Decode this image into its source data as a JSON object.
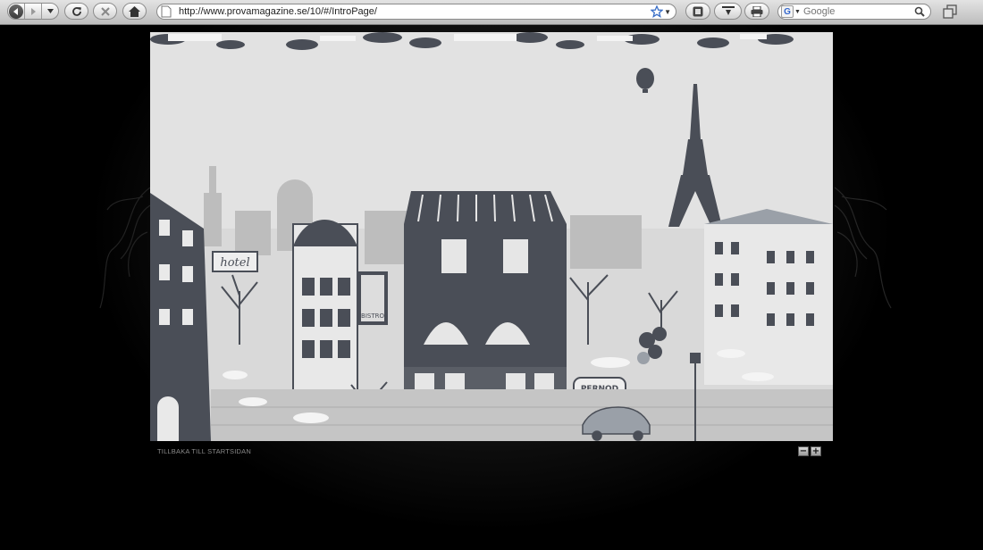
{
  "browser": {
    "address": "http://www.provamagazine.se/10/#/IntroPage/",
    "search_placeholder": "Google",
    "search_engine_badge": "G",
    "icons": [
      "back-icon",
      "forward-icon",
      "reload-icon",
      "stop-icon",
      "home-icon",
      "page-icon",
      "bookmark-star-icon",
      "snapback-icon",
      "download-icon",
      "print-icon",
      "search-icon",
      "window-icon"
    ]
  },
  "stage": {
    "signs": {
      "hotel": "hotel",
      "bistro": "BISTRO",
      "pernod": "PERNOD"
    }
  },
  "footer": {
    "back_link": "TILLBAKA TILL STARTSIDAN",
    "zoom_out": "−",
    "zoom_in": "+"
  },
  "colors": {
    "page_bg": "#000000",
    "illustration_dark": "#4a4e57",
    "illustration_light": "#e6e6e6"
  }
}
